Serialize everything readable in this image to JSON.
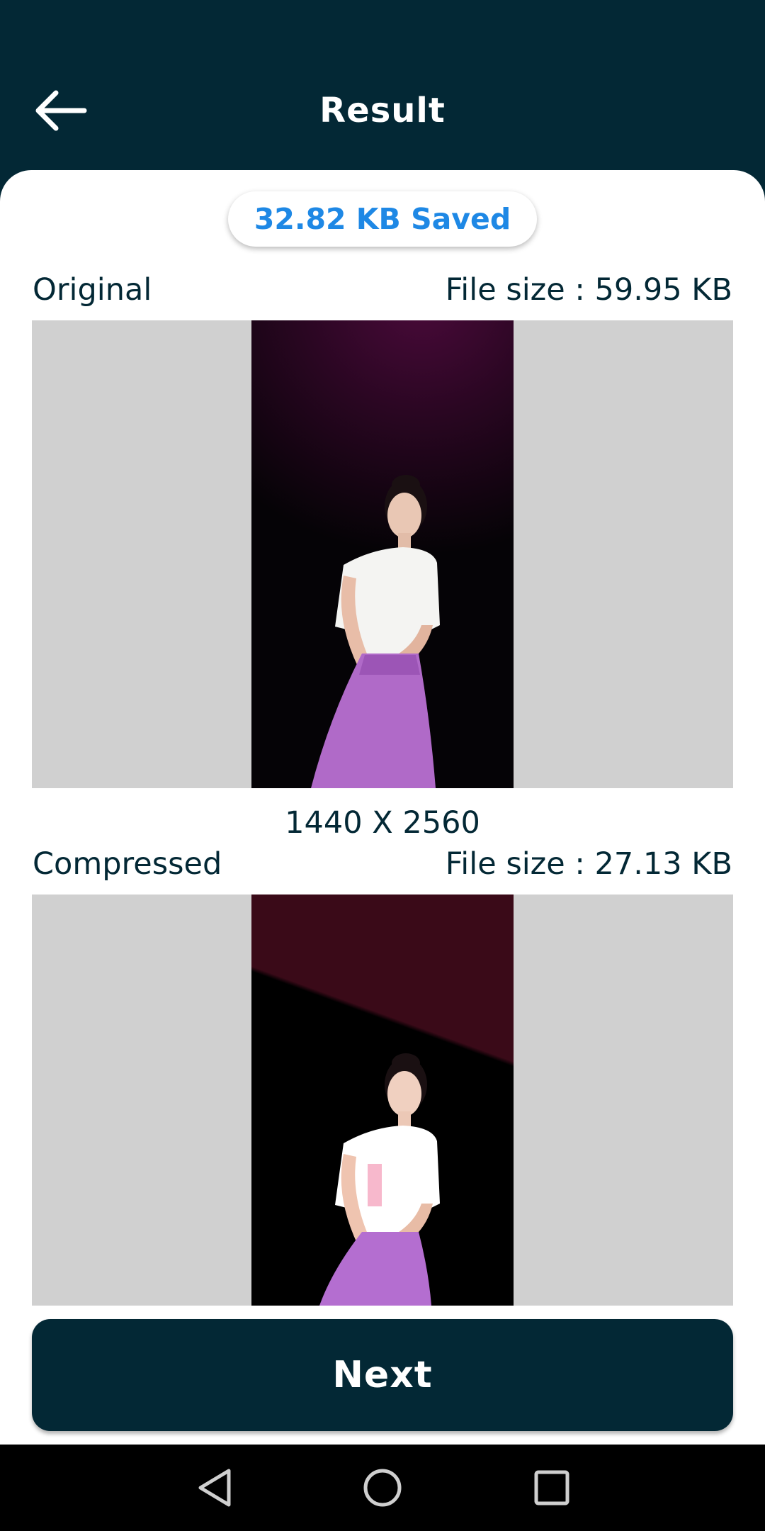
{
  "header": {
    "title": "Result",
    "back_icon": "arrow-left-icon"
  },
  "summary": {
    "saved_text": "32.82 KB Saved",
    "saved_color": "#1e88e5"
  },
  "original": {
    "label": "Original",
    "file_size": "File size : 59.95 KB",
    "dimensions": "1440 X 2560"
  },
  "compressed": {
    "label": "Compressed",
    "file_size": "File size : 27.13 KB"
  },
  "actions": {
    "next_label": "Next"
  },
  "system_nav": {
    "back_icon": "nav-back-icon",
    "home_icon": "nav-home-icon",
    "recents_icon": "nav-recents-icon"
  },
  "colors": {
    "primary": "#032835",
    "accent": "#1e88e5",
    "placeholder_bg": "#d0d0d0"
  }
}
